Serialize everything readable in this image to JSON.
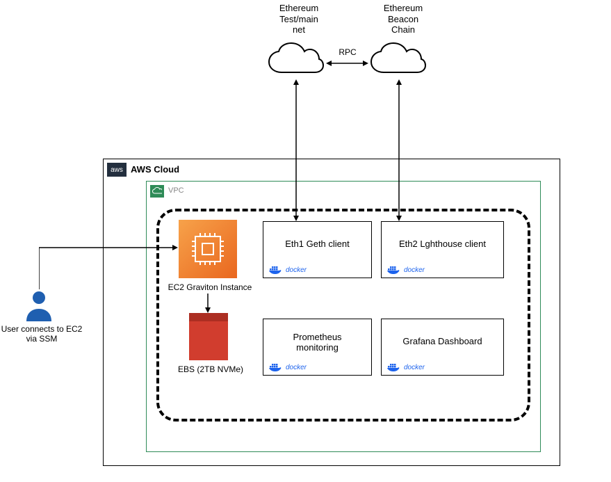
{
  "clouds": {
    "ethereum_main": "Ethereum\nTest/main\nnet",
    "ethereum_beacon": "Ethereum\nBeacon\nChain",
    "rpc_label": "RPC"
  },
  "aws": {
    "cloud_label": "AWS Cloud",
    "vpc_label": "VPC",
    "ec2_label": "EC2 Graviton Instance",
    "ebs_label": "EBS (2TB NVMe)"
  },
  "services": {
    "geth": "Eth1 Geth client",
    "lighthouse": "Eth2 Lghthouse client",
    "prometheus": "Prometheus\nmonitoring",
    "grafana": "Grafana Dashboard",
    "docker_label": "docker"
  },
  "user": {
    "label": "User connects to EC2\nvia SSM"
  }
}
